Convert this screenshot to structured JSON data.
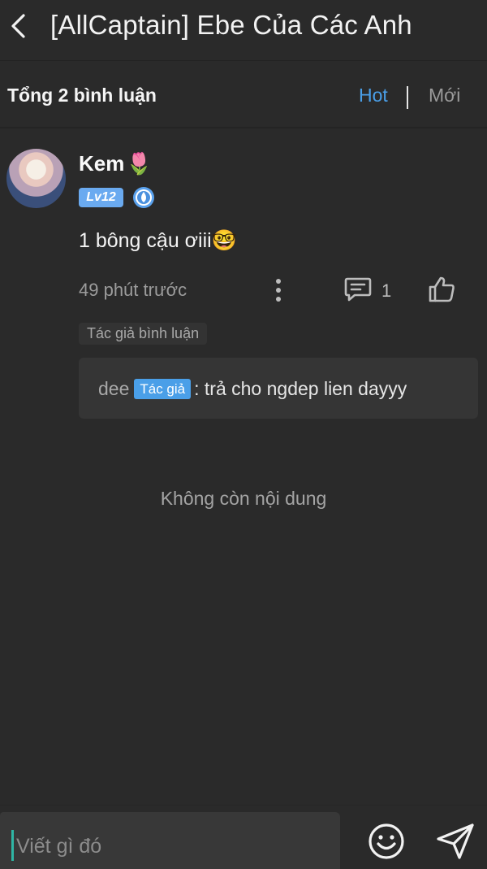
{
  "header": {
    "title": "[AllCaptain] Ebe Của Các Anh",
    "back_icon": "chevron-left-icon"
  },
  "filter_bar": {
    "total_label": "Tổng 2 bình luận",
    "tab_hot": "Hot",
    "tab_new": "Mới",
    "active_tab": "Hot",
    "accent_color": "#4a9fe8"
  },
  "comment": {
    "username": "Kem",
    "username_emoji": "🌷",
    "level": "Lv12",
    "medal_icon": "medal-icon",
    "text": "1 bông cậu ơiii🤓",
    "time": "49 phút trước",
    "more_icon": "more-vertical-icon",
    "reply_icon": "comment-icon",
    "reply_count": "1",
    "like_icon": "thumbs-up-icon",
    "author_tag": "Tác giả bình luận",
    "reply": {
      "name": "dee",
      "badge": "Tác giả",
      "text": ": trả cho ngdep lien dayyy"
    }
  },
  "empty_note": "Không còn nội dung",
  "bottom_bar": {
    "placeholder": "Viết gì đó",
    "emoji_icon": "smiley-icon",
    "send_icon": "send-icon"
  }
}
